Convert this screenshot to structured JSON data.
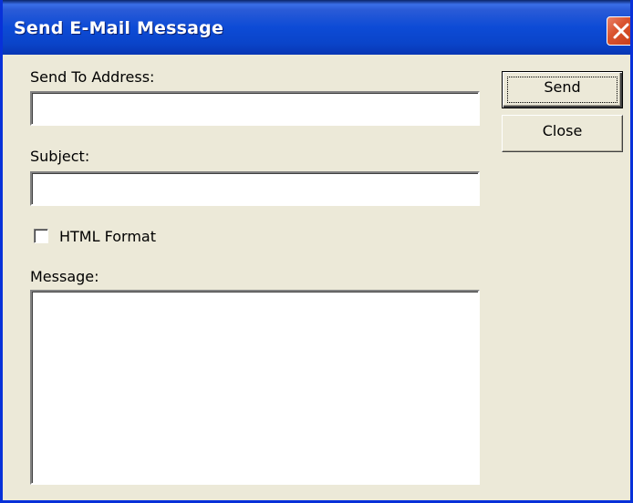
{
  "window": {
    "title": "Send E-Mail Message",
    "close_icon": "close-icon"
  },
  "form": {
    "to_label": "Send To Address:",
    "to_value": "",
    "subject_label": "Subject:",
    "subject_value": "",
    "html_format_label": "HTML Format",
    "html_format_checked": false,
    "message_label": "Message:",
    "message_value": ""
  },
  "buttons": {
    "send_label": "Send",
    "close_label": "Close"
  },
  "colors": {
    "titlebar": "#0a44c9",
    "window_bg": "#ece9d8",
    "close_button": "#d9532f"
  }
}
